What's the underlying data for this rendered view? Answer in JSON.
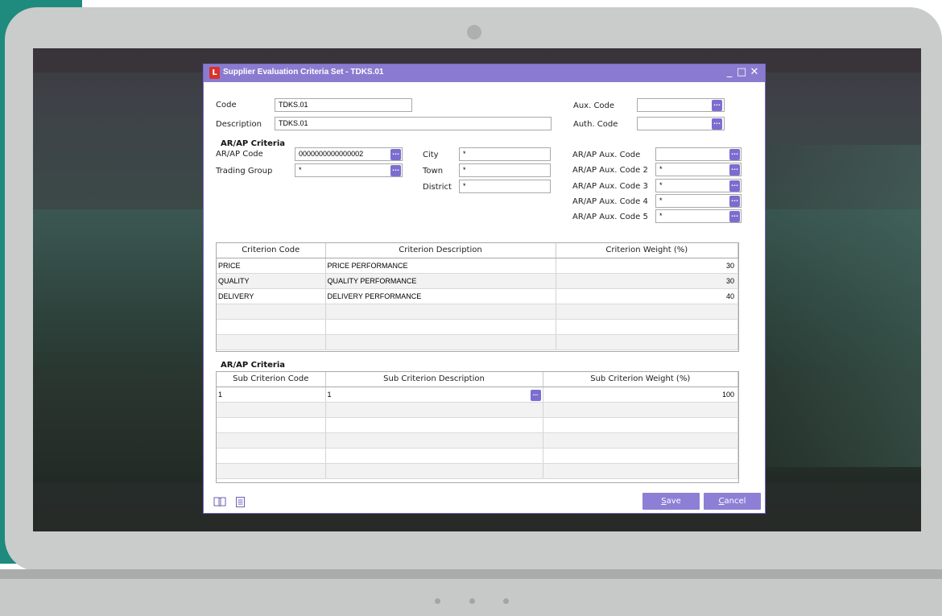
{
  "window": {
    "title": "Supplier Evaluation Criteria Set - TDKS.01",
    "app_icon_letter": "L",
    "minimize": "_",
    "maximize": "□",
    "close": "✕"
  },
  "header": {
    "code_label": "Code",
    "code_value": "TDKS.01",
    "description_label": "Description",
    "description_value": "TDKS.01",
    "aux_code_label": "Aux. Code",
    "aux_code_value": "",
    "auth_code_label": "Auth. Code",
    "auth_code_value": ""
  },
  "arap_criteria": {
    "section_title": "AR/AP Criteria",
    "arap_code_label": "AR/AP Code",
    "arap_code_value": "0000000000000002",
    "trading_group_label": "Trading Group",
    "trading_group_value": "*",
    "city_label": "City",
    "city_value": "*",
    "town_label": "Town",
    "town_value": "*",
    "district_label": "District",
    "district_value": "*",
    "aux_codes": [
      {
        "label": "AR/AP Aux. Code",
        "value": ""
      },
      {
        "label": "AR/AP Aux. Code 2",
        "value": "*"
      },
      {
        "label": "AR/AP Aux. Code 3",
        "value": "*"
      },
      {
        "label": "AR/AP Aux. Code 4",
        "value": "*"
      },
      {
        "label": "AR/AP Aux. Code 5",
        "value": "*"
      }
    ],
    "lookup_button": "..."
  },
  "criteria_grid": {
    "headers": [
      "Criterion Code",
      "Criterion Description",
      "Criterion Weight (%)"
    ],
    "rows": [
      {
        "code": "PRICE",
        "description": "PRICE PERFORMANCE",
        "weight": "30"
      },
      {
        "code": "QUALITY",
        "description": "QUALITY PERFORMANCE",
        "weight": "30"
      },
      {
        "code": "DELIVERY",
        "description": "DELIVERY PERFORMANCE",
        "weight": "40"
      }
    ]
  },
  "sub_criteria": {
    "section_title": "AR/AP Criteria",
    "headers": [
      "Sub Criterion Code",
      "Sub Criterion Description",
      "Sub Criterion Weight (%)"
    ],
    "rows": [
      {
        "code": "1",
        "description": "1",
        "weight": "100"
      }
    ]
  },
  "footer": {
    "save_label": "Save",
    "save_underline": "S",
    "save_rest": "ave",
    "cancel_label": "Cancel",
    "cancel_underline": "C",
    "cancel_rest": "ancel",
    "book_icon": "book-icon",
    "document_icon": "document-icon"
  },
  "colors": {
    "accent": "#8b7bd0",
    "button": "#8e7fd6",
    "teal": "#1f8a7e"
  }
}
